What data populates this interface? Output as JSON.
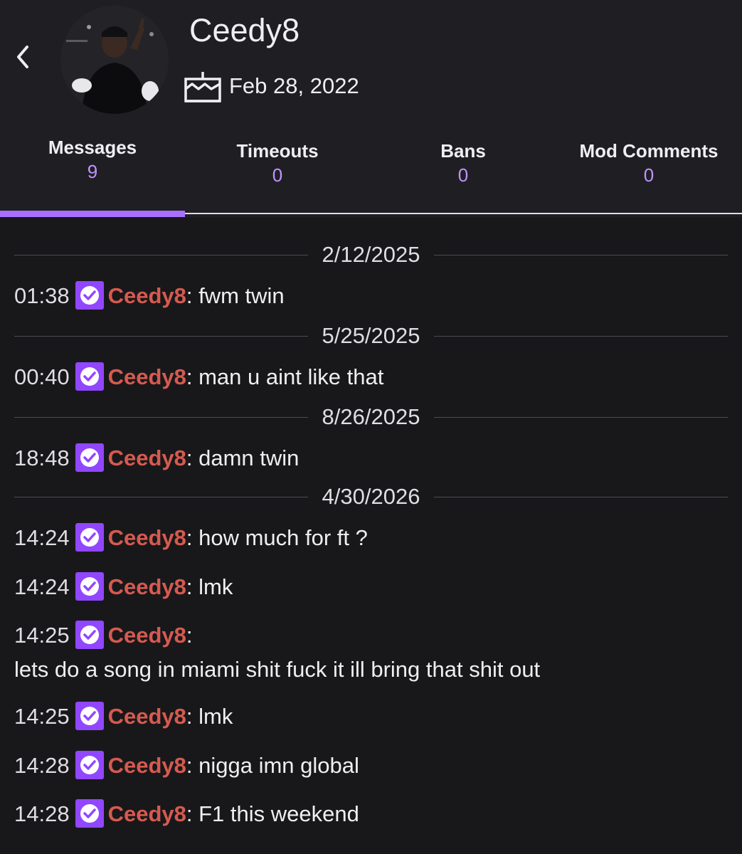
{
  "profile": {
    "username": "Ceedy8",
    "created_date": "Feb 28, 2022"
  },
  "tabs": [
    {
      "label": "Messages",
      "count": "9",
      "active": true
    },
    {
      "label": "Timeouts",
      "count": "0",
      "active": false
    },
    {
      "label": "Bans",
      "count": "0",
      "active": false
    },
    {
      "label": "Mod Comments",
      "count": "0",
      "active": false
    }
  ],
  "log": {
    "dates": [
      "2/12/2025",
      "5/25/2025",
      "8/26/2025",
      "4/30/2026"
    ],
    "messages": [
      {
        "time": "01:38",
        "author": "Ceedy8",
        "text": "fwm twin"
      },
      {
        "time": "00:40",
        "author": "Ceedy8",
        "text": "man u aint like that"
      },
      {
        "time": "18:48",
        "author": "Ceedy8",
        "text": "damn twin"
      },
      {
        "time": "14:24",
        "author": "Ceedy8",
        "text": "how much for ft ?"
      },
      {
        "time": "14:24",
        "author": "Ceedy8",
        "text": "lmk"
      },
      {
        "time": "14:25",
        "author": "Ceedy8",
        "text": "lets do a song in miami shit fuck it ill bring that shit out"
      },
      {
        "time": "14:25",
        "author": "Ceedy8",
        "text": "lmk"
      },
      {
        "time": "14:28",
        "author": "Ceedy8",
        "text": "nigga imn global"
      },
      {
        "time": "14:28",
        "author": "Ceedy8",
        "text": "F1 this weekend"
      }
    ]
  },
  "colors": {
    "accent": "#a970ff",
    "author": "#d65a4f",
    "background": "#18181b"
  },
  "icons": {
    "back": "chevron-left-icon",
    "cake": "cake-icon",
    "badge": "verified-badge-icon"
  }
}
